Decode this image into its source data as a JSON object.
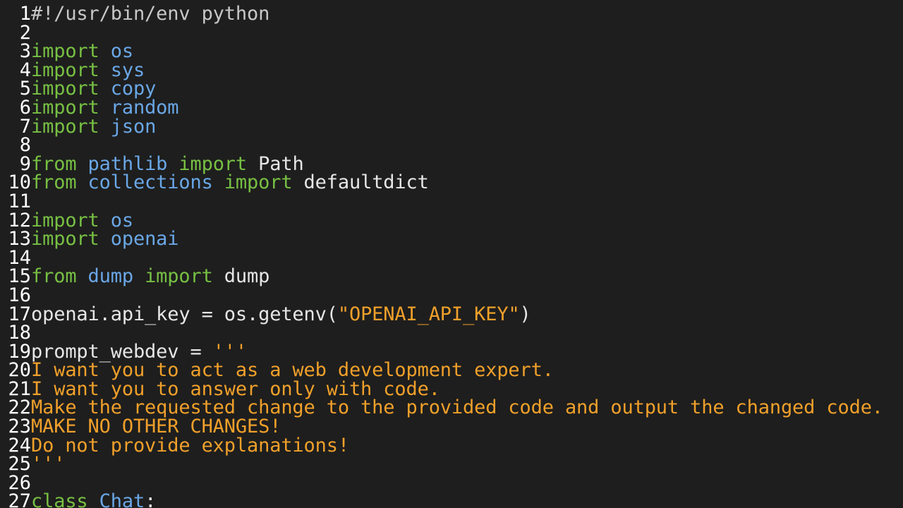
{
  "colors": {
    "background": "#1e1e1e",
    "line_number": "#ffffff",
    "comment": "#c8c8c8",
    "keyword": "#77c043",
    "module": "#6aa7e6",
    "plain": "#e6e6e6",
    "string": "#f0a02a",
    "class_name": "#6aa7e6"
  },
  "lines": [
    {
      "n": "1",
      "tokens": [
        {
          "t": "#!/usr/bin/env python",
          "c": "comment"
        }
      ]
    },
    {
      "n": "2",
      "tokens": []
    },
    {
      "n": "3",
      "tokens": [
        {
          "t": "import",
          "c": "kw"
        },
        {
          "t": " ",
          "c": "plain"
        },
        {
          "t": "os",
          "c": "mod"
        }
      ]
    },
    {
      "n": "4",
      "tokens": [
        {
          "t": "import",
          "c": "kw"
        },
        {
          "t": " ",
          "c": "plain"
        },
        {
          "t": "sys",
          "c": "mod"
        }
      ]
    },
    {
      "n": "5",
      "tokens": [
        {
          "t": "import",
          "c": "kw"
        },
        {
          "t": " ",
          "c": "plain"
        },
        {
          "t": "copy",
          "c": "mod"
        }
      ]
    },
    {
      "n": "6",
      "tokens": [
        {
          "t": "import",
          "c": "kw"
        },
        {
          "t": " ",
          "c": "plain"
        },
        {
          "t": "random",
          "c": "mod"
        }
      ]
    },
    {
      "n": "7",
      "tokens": [
        {
          "t": "import",
          "c": "kw"
        },
        {
          "t": " ",
          "c": "plain"
        },
        {
          "t": "json",
          "c": "mod"
        }
      ]
    },
    {
      "n": "8",
      "tokens": []
    },
    {
      "n": "9",
      "tokens": [
        {
          "t": "from",
          "c": "kw"
        },
        {
          "t": " ",
          "c": "plain"
        },
        {
          "t": "pathlib",
          "c": "mod"
        },
        {
          "t": " ",
          "c": "plain"
        },
        {
          "t": "import",
          "c": "kw"
        },
        {
          "t": " Path",
          "c": "plain"
        }
      ]
    },
    {
      "n": "10",
      "tokens": [
        {
          "t": "from",
          "c": "kw"
        },
        {
          "t": " ",
          "c": "plain"
        },
        {
          "t": "collections",
          "c": "mod"
        },
        {
          "t": " ",
          "c": "plain"
        },
        {
          "t": "import",
          "c": "kw"
        },
        {
          "t": " defaultdict",
          "c": "plain"
        }
      ]
    },
    {
      "n": "11",
      "tokens": []
    },
    {
      "n": "12",
      "tokens": [
        {
          "t": "import",
          "c": "kw"
        },
        {
          "t": " ",
          "c": "plain"
        },
        {
          "t": "os",
          "c": "mod"
        }
      ]
    },
    {
      "n": "13",
      "tokens": [
        {
          "t": "import",
          "c": "kw"
        },
        {
          "t": " ",
          "c": "plain"
        },
        {
          "t": "openai",
          "c": "mod"
        }
      ]
    },
    {
      "n": "14",
      "tokens": []
    },
    {
      "n": "15",
      "tokens": [
        {
          "t": "from",
          "c": "kw"
        },
        {
          "t": " ",
          "c": "plain"
        },
        {
          "t": "dump",
          "c": "mod"
        },
        {
          "t": " ",
          "c": "plain"
        },
        {
          "t": "import",
          "c": "kw"
        },
        {
          "t": " dump",
          "c": "plain"
        }
      ]
    },
    {
      "n": "16",
      "tokens": []
    },
    {
      "n": "17",
      "tokens": [
        {
          "t": "openai.api_key = os.getenv(",
          "c": "plain"
        },
        {
          "t": "\"OPENAI_API_KEY\"",
          "c": "str"
        },
        {
          "t": ")",
          "c": "plain"
        }
      ]
    },
    {
      "n": "18",
      "tokens": []
    },
    {
      "n": "19",
      "tokens": [
        {
          "t": "prompt_webdev = ",
          "c": "plain"
        },
        {
          "t": "'''",
          "c": "str"
        }
      ]
    },
    {
      "n": "20",
      "tokens": [
        {
          "t": "I want you to act as a web development expert.",
          "c": "str"
        }
      ]
    },
    {
      "n": "21",
      "tokens": [
        {
          "t": "I want you to answer only with code.",
          "c": "str"
        }
      ]
    },
    {
      "n": "22",
      "tokens": [
        {
          "t": "Make the requested change to the provided code and output the changed code.",
          "c": "str"
        }
      ]
    },
    {
      "n": "23",
      "tokens": [
        {
          "t": "MAKE NO OTHER CHANGES!",
          "c": "str"
        }
      ]
    },
    {
      "n": "24",
      "tokens": [
        {
          "t": "Do not provide explanations!",
          "c": "str"
        }
      ]
    },
    {
      "n": "25",
      "tokens": [
        {
          "t": "'''",
          "c": "str"
        }
      ]
    },
    {
      "n": "26",
      "tokens": []
    },
    {
      "n": "27",
      "tokens": [
        {
          "t": "class",
          "c": "kw"
        },
        {
          "t": " ",
          "c": "plain"
        },
        {
          "t": "Chat",
          "c": "cls"
        },
        {
          "t": ":",
          "c": "plain"
        }
      ]
    }
  ]
}
